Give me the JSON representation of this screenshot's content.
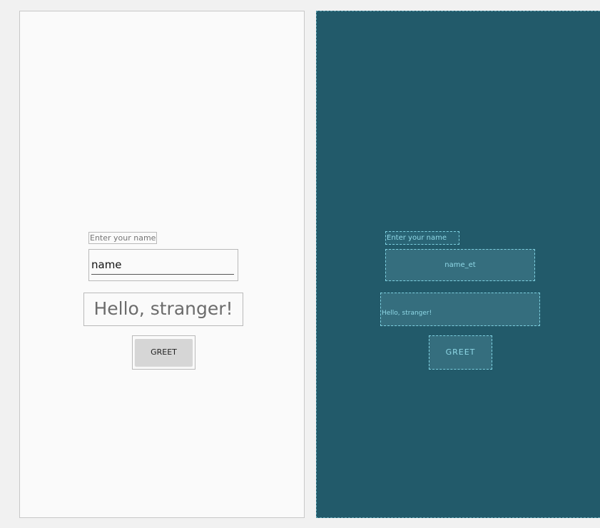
{
  "design": {
    "hint": "Enter your name",
    "input_value": "name",
    "greeting": "Hello, stranger!",
    "button_label": "GREET"
  },
  "blueprint": {
    "hint": "Enter your name",
    "input_id": "name_et",
    "greeting": "Hello, stranger!",
    "button_label": "GREET"
  },
  "colors": {
    "design_background": "#fafafa",
    "blueprint_background": "#225a6a",
    "blueprint_accent": "#7ed0e0"
  }
}
